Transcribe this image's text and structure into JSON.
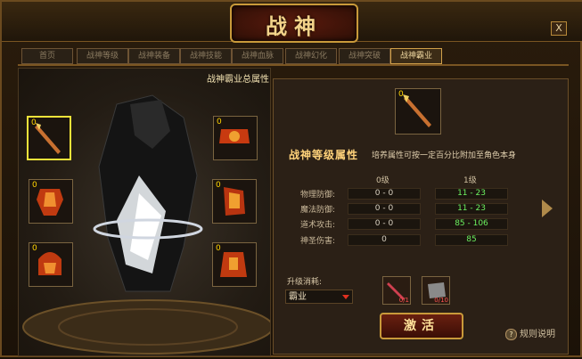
{
  "window": {
    "title": "战神",
    "close_label": "X"
  },
  "tabs": [
    "首页",
    "战神等级",
    "战神装备",
    "战神技能",
    "战神血脉",
    "战神幻化",
    "战神突破",
    "战神霸业"
  ],
  "left": {
    "panel_title": "战神霸业总属性",
    "slots": [
      "0",
      "0",
      "0",
      "0",
      "0",
      "0"
    ]
  },
  "right": {
    "top_slot_count": "0",
    "section_title": "战神等级属性",
    "section_sub": "培养属性可按一定百分比附加至角色本身",
    "col0": "0级",
    "col1": "1级",
    "rows": [
      {
        "label": "物理防御:",
        "v0": "0 - 0",
        "v1": "11 - 23"
      },
      {
        "label": "魔法防御:",
        "v0": "0 - 0",
        "v1": "11 - 23"
      },
      {
        "label": "道术攻击:",
        "v0": "0 - 0",
        "v1": "85 - 106"
      },
      {
        "label": "神圣伤害:",
        "v0": "0",
        "v1": "85"
      }
    ],
    "consume_label": "升级消耗:",
    "dropdown_value": "霸业",
    "items": [
      {
        "count": "0/1"
      },
      {
        "count": "0/10"
      }
    ],
    "activate_label": "激活",
    "help_label": "规则说明"
  }
}
